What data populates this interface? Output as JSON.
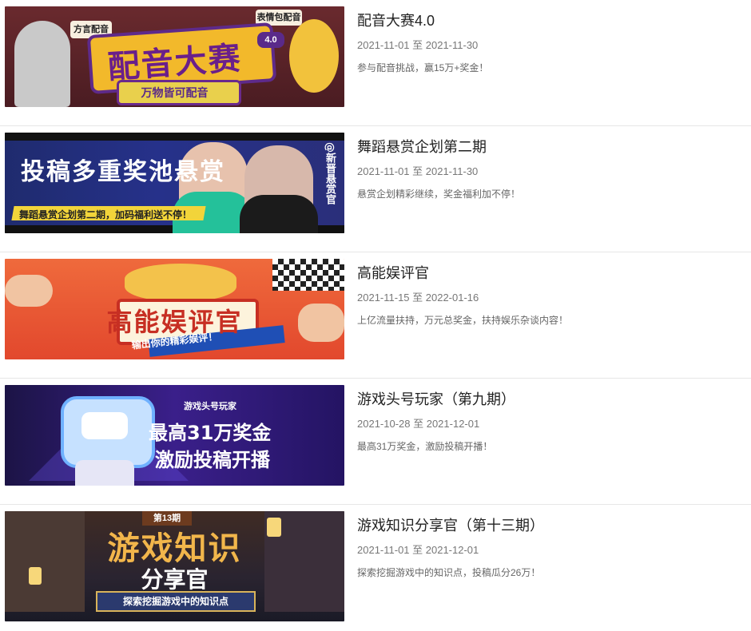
{
  "items": [
    {
      "title": "配音大赛4.0",
      "date": "2021-11-01 至 2021-11-30",
      "desc": "参与配音挑战，赢15万+奖金！",
      "banner": {
        "text": "配音大赛",
        "sub": "万物皆可配音",
        "bubble_left": "方言配音",
        "bubble_right": "表情包配音",
        "version": "4.0"
      }
    },
    {
      "title": "舞蹈悬赏企划第二期",
      "date": "2021-11-01 至 2021-11-30",
      "desc": "悬赏企划精彩继续，奖金福利加不停！",
      "banner": {
        "text": "投稿多重奖池悬赏",
        "sub": "舞蹈悬赏企划第二期，加码福利送不停！",
        "side": "@新晋悬赏官"
      }
    },
    {
      "title": "高能娱评官",
      "date": "2021-11-15 至 2022-01-16",
      "desc": "上亿流量扶持，万元总奖金，扶持娱乐杂谈内容！",
      "banner": {
        "text": "高能娱评官",
        "sub": "输出你的精彩娱评！"
      }
    },
    {
      "title": "游戏头号玩家（第九期）",
      "date": "2021-10-28 至 2021-12-01",
      "desc": "最高31万奖金，激励投稿开播！",
      "banner": {
        "tag": "游戏头号玩家",
        "line1": "最高31万奖金",
        "line2": "激励投稿开播"
      }
    },
    {
      "title": "游戏知识分享官（第十三期）",
      "date": "2021-11-01 至 2021-12-01",
      "desc": "探索挖掘游戏中的知识点，投稿瓜分26万！",
      "banner": {
        "tag": "第13期",
        "text": "游戏知识",
        "sub": "分享官",
        "ribbon": "探索挖掘游戏中的知识点"
      }
    }
  ]
}
